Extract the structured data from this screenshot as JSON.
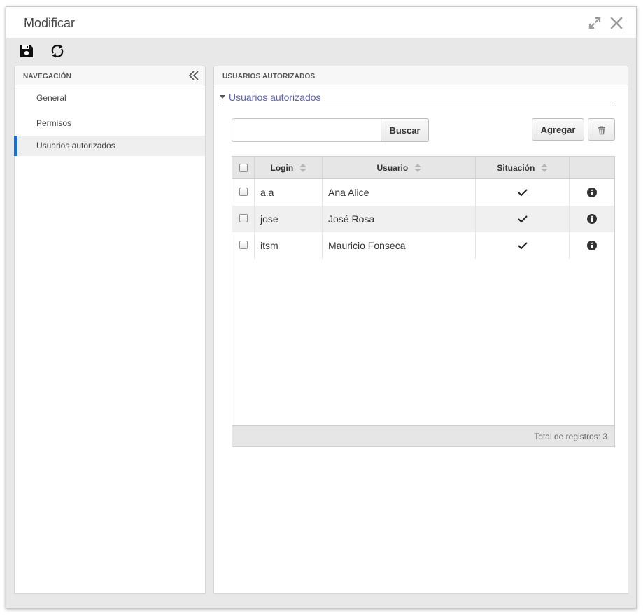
{
  "window": {
    "title": "Modificar"
  },
  "nav": {
    "header": "NAVEGACIÓN",
    "items": [
      {
        "label": "General",
        "active": false
      },
      {
        "label": "Permisos",
        "active": false
      },
      {
        "label": "Usuarios autorizados",
        "active": true
      }
    ]
  },
  "main": {
    "header": "USUARIOS AUTORIZADOS",
    "section_title": "Usuarios autorizados",
    "search": {
      "value": "",
      "button_label": "Buscar"
    },
    "add_label": "Agregar",
    "grid": {
      "columns": [
        "Login",
        "Usuario",
        "Situación"
      ],
      "rows": [
        {
          "login": "a.a",
          "usuario": "Ana Alice",
          "situacion": "check"
        },
        {
          "login": "jose",
          "usuario": "José Rosa",
          "situacion": "check"
        },
        {
          "login": "itsm",
          "usuario": "Mauricio Fonseca",
          "situacion": "check"
        }
      ],
      "footer": "Total de registros: 3"
    }
  },
  "colors": {
    "accent": "#1f6fc5",
    "link": "#5f63b4"
  }
}
